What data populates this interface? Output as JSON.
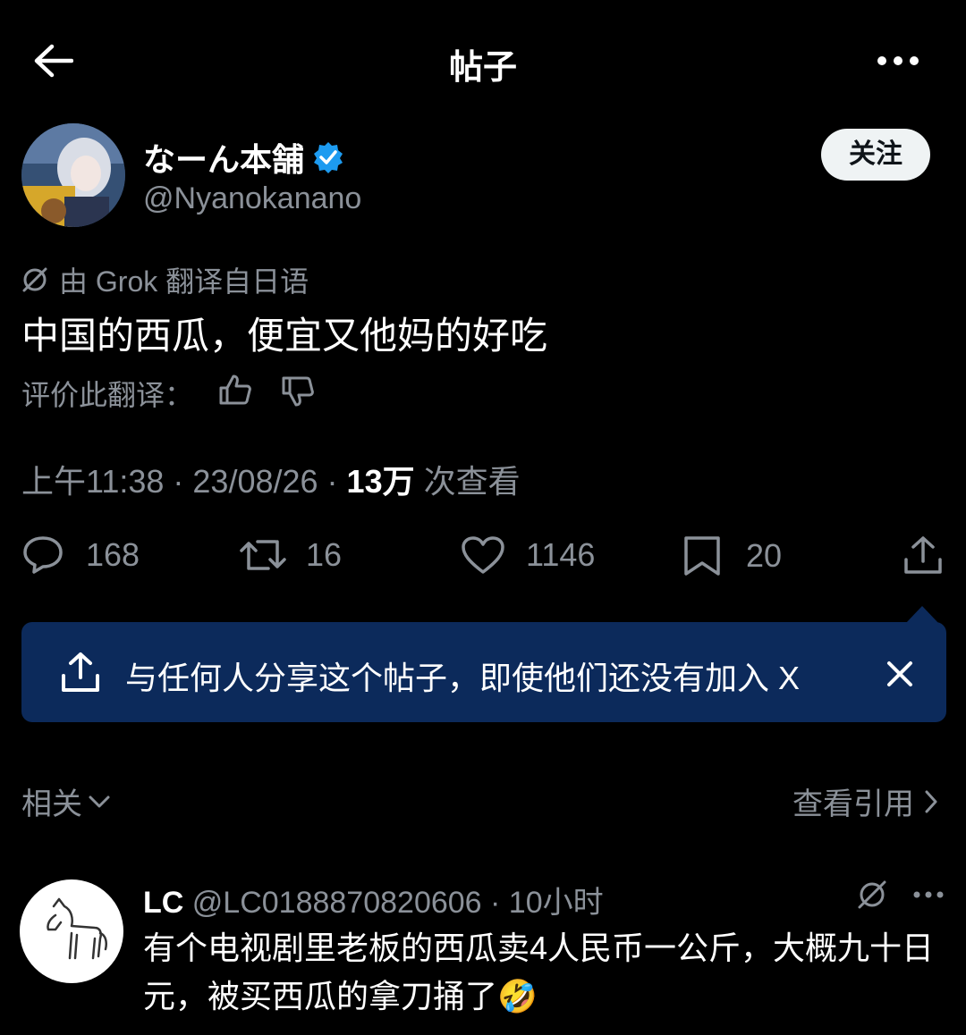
{
  "topbar": {
    "title": "帖子"
  },
  "author": {
    "name": "なーん本舗",
    "handle": "@Nyanokanano",
    "follow_label": "关注"
  },
  "translation": {
    "note": "由 Grok 翻译自日语",
    "rate_label": "评价此翻译："
  },
  "tweet": {
    "text": "中国的西瓜，便宜又他妈的好吃"
  },
  "meta": {
    "time": "上午11:38 · 23/08/26 · ",
    "views": "13万",
    "views_label": " 次查看"
  },
  "actions": {
    "replies": "168",
    "reposts": "16",
    "likes": "1146",
    "bookmarks": "20"
  },
  "share_banner": {
    "text": "与任何人分享这个帖子，即使他们还没有加入 X"
  },
  "related": {
    "label": "相关",
    "quotes_label": "查看引用"
  },
  "reply": {
    "name": "LC",
    "handle_time": "@LC0188870820606 · 10小时",
    "text": "有个电视剧里老板的西瓜卖4人民币一公斤，大概九十日元，被买西瓜的拿刀捅了🤣"
  },
  "colors": {
    "background": "#000000",
    "banner": "#0c2a5b",
    "verified": "#1d9bf0",
    "muted": "#8b9199"
  }
}
